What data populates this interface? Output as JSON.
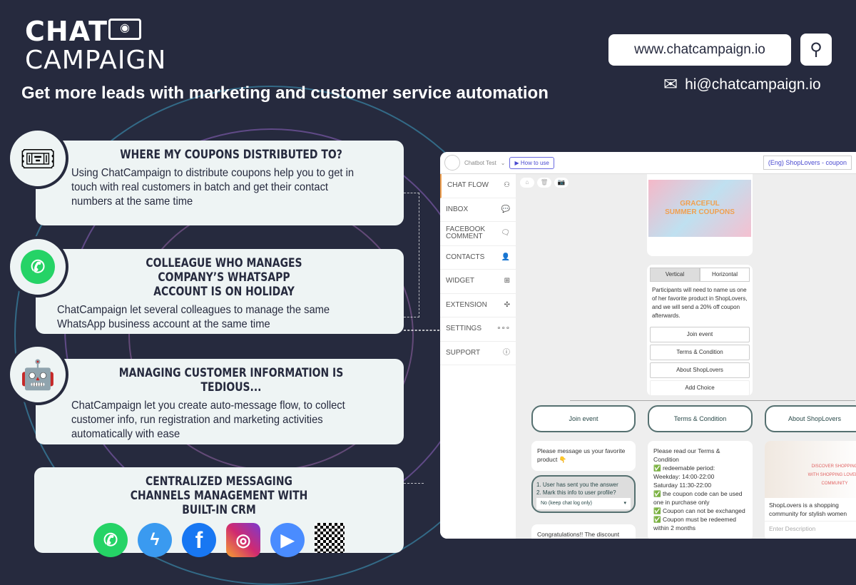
{
  "brand": {
    "logo_line1": "CHAT",
    "logo_line2": "CAMPAIGN",
    "tagline": "Get more leads with marketing and customer service automation",
    "website": "www.chatcampaign.io",
    "email": "hi@chatcampaign.io"
  },
  "features": [
    {
      "icon": "coupon-ticket-icon",
      "title": "Where my coupons distributed to?",
      "body": "Using ChatCampaign to distribute coupons help you to get in touch with real customers in batch and get their contact numbers at the same time"
    },
    {
      "icon": "whatsapp-icon",
      "title": "Colleague who manages company’s WhatsApp account is on holiday",
      "body": "ChatCampaign let several colleagues to manage the same WhatsApp business account at the same time"
    },
    {
      "icon": "robot-icon",
      "title": "Managing customer information is tedious...",
      "body": "ChatCampaign let you create auto-message flow, to collect customer info, run registration and marketing activities automatically with ease"
    },
    {
      "title": "Centralized messaging channels management with built-in CRM",
      "channels": [
        "whatsapp-icon",
        "messenger-icon",
        "facebook-icon",
        "instagram-icon",
        "zoom-icon",
        "qr-code-icon"
      ]
    }
  ],
  "app": {
    "bot_name": "Chatbot Test",
    "how_to_use": "How to use",
    "flow_select": "(Eng) ShopLovers - coupon",
    "sidebar": [
      "CHAT FLOW",
      "INBOX",
      "FACEBOOK COMMENT",
      "CONTACTS",
      "WIDGET",
      "EXTENSION",
      "SETTINGS",
      "SUPPORT"
    ],
    "banner_text": "GRACEFUL SUMMER COUPONS",
    "layout_tabs": [
      "Vertical",
      "Horizontal"
    ],
    "intro": "Participants will need to name us one of her favorite product in ShopLovers, and we will send a 20% off coupon afterwards.",
    "choices": [
      "Join event",
      "Terms & Condition",
      "About ShopLovers",
      "Add Choice"
    ],
    "branches": [
      "Join event",
      "Terms & Condition",
      "About ShopLovers"
    ],
    "join_msg": "Please message us your favorite product 👇",
    "condition": "1. User has sent you the answer\n2. Mark this info to user profile?",
    "condition_select": "No (keep chat log only)",
    "congrats": "Congratulations!! The discount",
    "terms": "Please read our Terms & Condition\n✅ redeemable period:\nWeekday: 14:00-22:00\nSaturday 11:30-22:00\n✅ the coupon code can be used one in purchase only\n✅ Coupon can not be exchanged\n✅ Coupon must be redeemed within 2 months",
    "about_caption": "ShopLovers is a shopping community for stylish women",
    "about_desc_placeholder": "Enter Description",
    "about_image_text": "DISCOVER SHOPPING WITH SHOPPING LOVERS COMMUNITY"
  }
}
